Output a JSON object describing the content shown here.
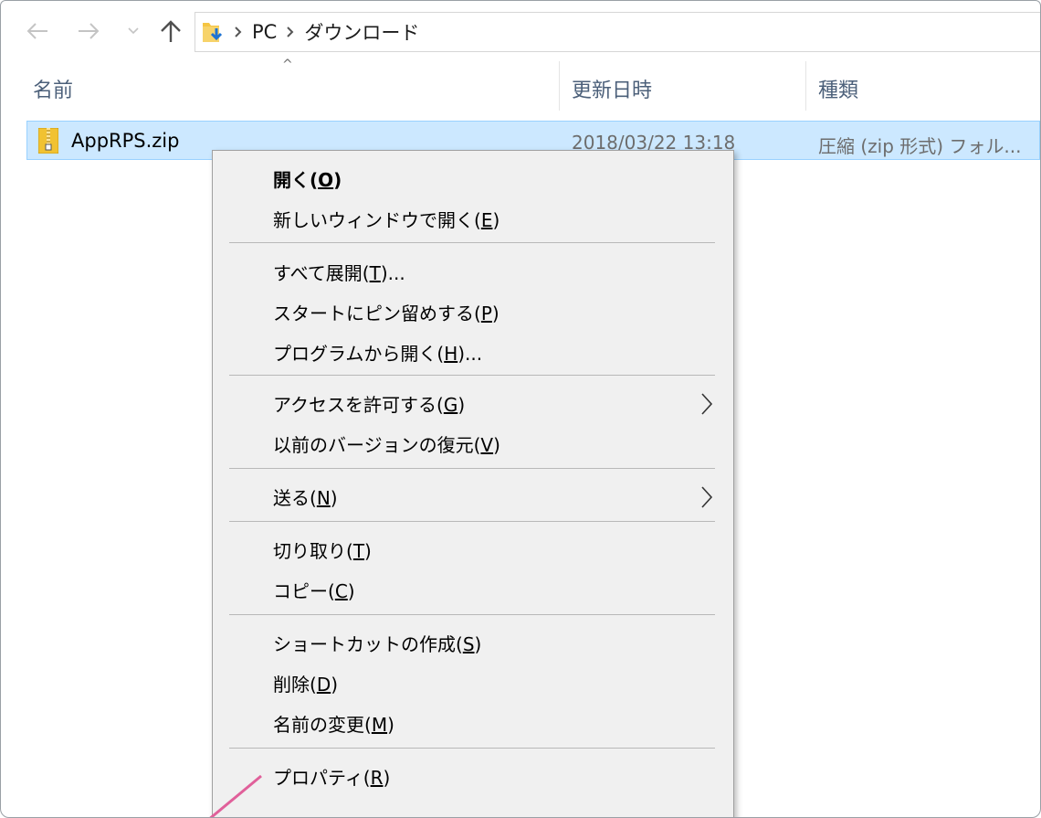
{
  "toolbar": {
    "back_icon": "back-arrow-icon",
    "forward_icon": "forward-arrow-icon",
    "recent_icon": "chevron-down-icon",
    "up_icon": "up-arrow-icon"
  },
  "address": {
    "icon": "downloads-folder-icon",
    "crumbs": [
      "PC",
      "ダウンロード"
    ]
  },
  "columns": {
    "sort_indicator": "^",
    "name": "名前",
    "modified": "更新日時",
    "type": "種類"
  },
  "file": {
    "icon": "zip-folder-icon",
    "name": "AppRPS.zip",
    "modified": "2018/03/22 13:18",
    "type": "圧縮 (zip 形式) フォル..."
  },
  "menu": {
    "items": [
      {
        "pre": "開く(",
        "key": "O",
        "post": ")",
        "bold": true
      },
      {
        "pre": "新しいウィンドウで開く(",
        "key": "E",
        "post": ")"
      },
      {
        "pre": "すべて展開(",
        "key": "T",
        "post": ")..."
      },
      {
        "pre": "スタートにピン留めする(",
        "key": "P",
        "post": ")"
      },
      {
        "pre": "プログラムから開く(",
        "key": "H",
        "post": ")..."
      },
      {
        "pre": "アクセスを許可する(",
        "key": "G",
        "post": ")",
        "submenu": true
      },
      {
        "pre": "以前のバージョンの復元(",
        "key": "V",
        "post": ")"
      },
      {
        "pre": "送る(",
        "key": "N",
        "post": ")",
        "submenu": true
      },
      {
        "pre": "切り取り(",
        "key": "T",
        "post": ")"
      },
      {
        "pre": "コピー(",
        "key": "C",
        "post": ")"
      },
      {
        "pre": "ショートカットの作成(",
        "key": "S",
        "post": ")"
      },
      {
        "pre": "削除(",
        "key": "D",
        "post": ")"
      },
      {
        "pre": "名前の変更(",
        "key": "M",
        "post": ")"
      },
      {
        "pre": "プロパティ(",
        "key": "R",
        "post": ")"
      }
    ]
  },
  "colors": {
    "selection_bg": "#cce8ff",
    "selection_border": "#99d1ff",
    "menu_bg": "#f0f0f0",
    "header_text": "#4c607a",
    "pointer": "#e0609a"
  }
}
